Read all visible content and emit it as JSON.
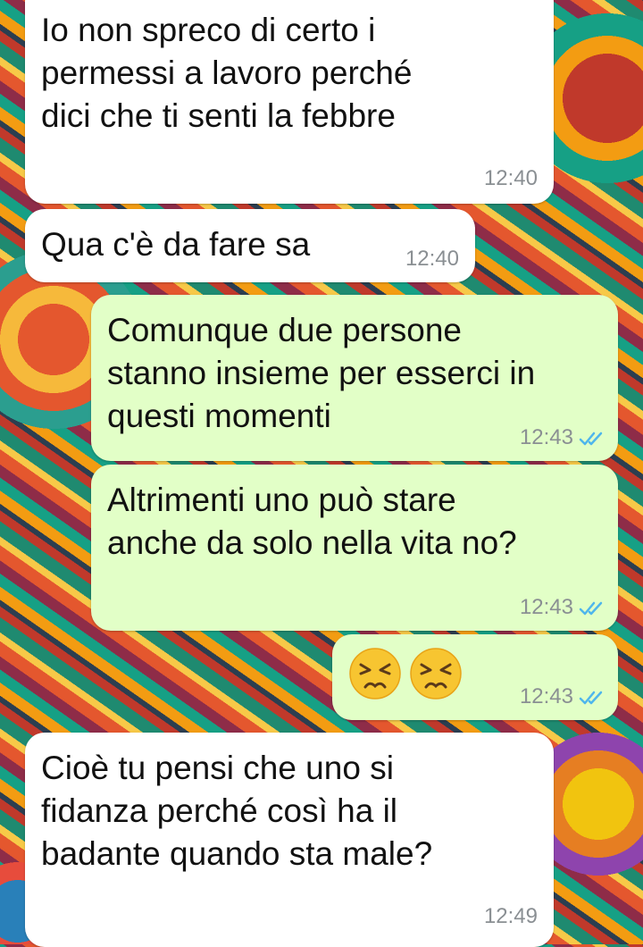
{
  "messages": [
    {
      "direction": "incoming",
      "text": "Io non spreco di certo i\npermessi a lavoro perché\ndici che ti senti la febbre",
      "time": "12:40"
    },
    {
      "direction": "incoming",
      "text": "Qua c'è da fare sa",
      "time": "12:40"
    },
    {
      "direction": "outgoing",
      "text": "Comunque due persone\nstanno insieme per esserci in\nquesti momenti",
      "time": "12:43",
      "status": "read"
    },
    {
      "direction": "outgoing",
      "text": "Altrimenti uno può stare\nanche da solo nella vita no?",
      "time": "12:43",
      "status": "read"
    },
    {
      "direction": "outgoing",
      "emoji": [
        "persevering-face-emoji",
        "persevering-face-emoji"
      ],
      "time": "12:43",
      "status": "read"
    },
    {
      "direction": "incoming",
      "text": "Cioè tu pensi che uno si\nfidanza perché così ha il\nbadante quando sta male?",
      "time": "12:49"
    }
  ],
  "colors": {
    "incoming_bubble": "#ffffff",
    "outgoing_bubble": "#e2ffc7",
    "timestamp": "#8a8f93",
    "read_ticks": "#4fb6ec",
    "emoji_face": "#f7c531"
  }
}
